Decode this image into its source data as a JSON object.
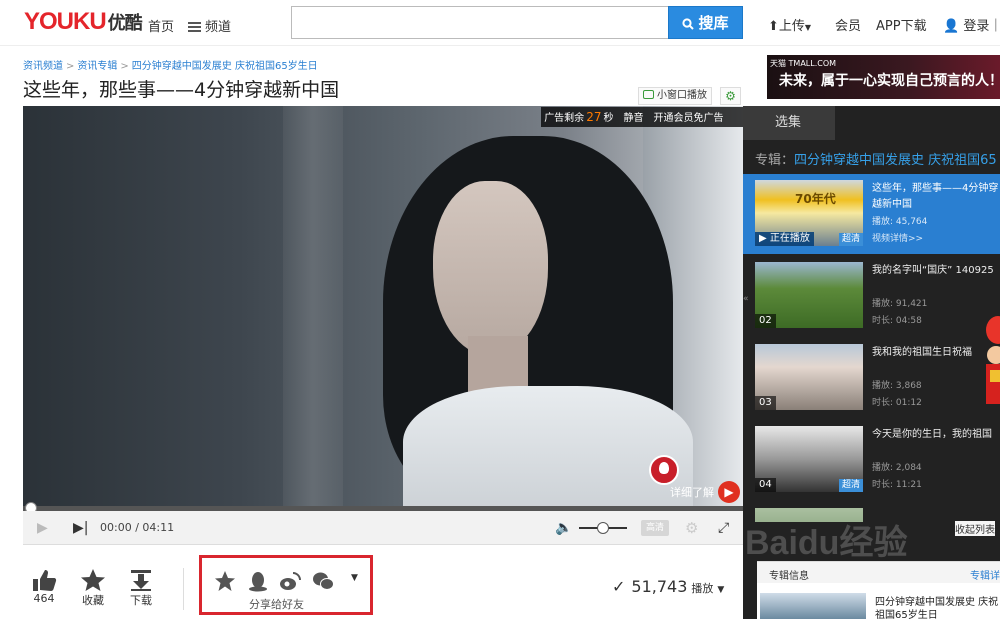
{
  "header": {
    "logo": "YOUKU",
    "logo_cn": "优酷",
    "nav_home": "首页",
    "nav_channel": "频道",
    "search_placeholder": "",
    "search_button": "搜库",
    "upload": "上传",
    "member": "会员",
    "app_download": "APP下载",
    "login": "登录｜注"
  },
  "breadcrumb": [
    "资讯频道",
    "资讯专辑",
    "四分钟穿越中国发展史 庆祝祖国65岁生日"
  ],
  "title": "这些年，那些事——4分钟穿越新中国",
  "mini_play": "小窗口播放",
  "player": {
    "ad_prefix": "广告剩余",
    "ad_countdown": "27",
    "ad_unit": "秒",
    "mute": "静音",
    "vip_no_ads": "开通会员免广告",
    "learn_more": "详细了解",
    "timecode": "00:00 / 04:11",
    "quality": "高清"
  },
  "actions": {
    "like_count": "464",
    "favorite": "收藏",
    "download": "下载",
    "share_label": "分享给好友",
    "play_count": "51,743",
    "play_unit": "播放"
  },
  "sidebar": {
    "ad_brand": "天猫 TMALL.COM",
    "ad_slogan": "未来，属于一心实现自己预言的人！",
    "tab": "选集",
    "album_prefix": "专辑：",
    "album_name": "四分钟穿越中国发展史 庆祝祖国65",
    "episodes": [
      {
        "no": "",
        "title": "这些年，那些事——4分钟穿越新中国",
        "m1": "播放: 45,764",
        "m2": "视频详情>>",
        "now": "正在播放",
        "hd": "超清",
        "thumb_text": "70年代"
      },
      {
        "no": "02",
        "title": "我的名字叫“国庆” 140925",
        "m1": "播放: 91,421",
        "m2": "时长: 04:58",
        "hd": ""
      },
      {
        "no": "03",
        "title": "我和我的祖国生日祝福",
        "m1": "播放: 3,868",
        "m2": "时长: 01:12",
        "hd": ""
      },
      {
        "no": "04",
        "title": "今天是你的生日，我的祖国",
        "m1": "播放: 2,084",
        "m2": "时长: 11:21",
        "hd": "超清"
      }
    ],
    "collapse_list": "收起列表",
    "album_info": "专辑信息",
    "album_info_more": "专辑详",
    "album_info_title": "四分钟穿越中国发展史 庆祝祖国65岁生日"
  },
  "watermark": "Baidu经验"
}
